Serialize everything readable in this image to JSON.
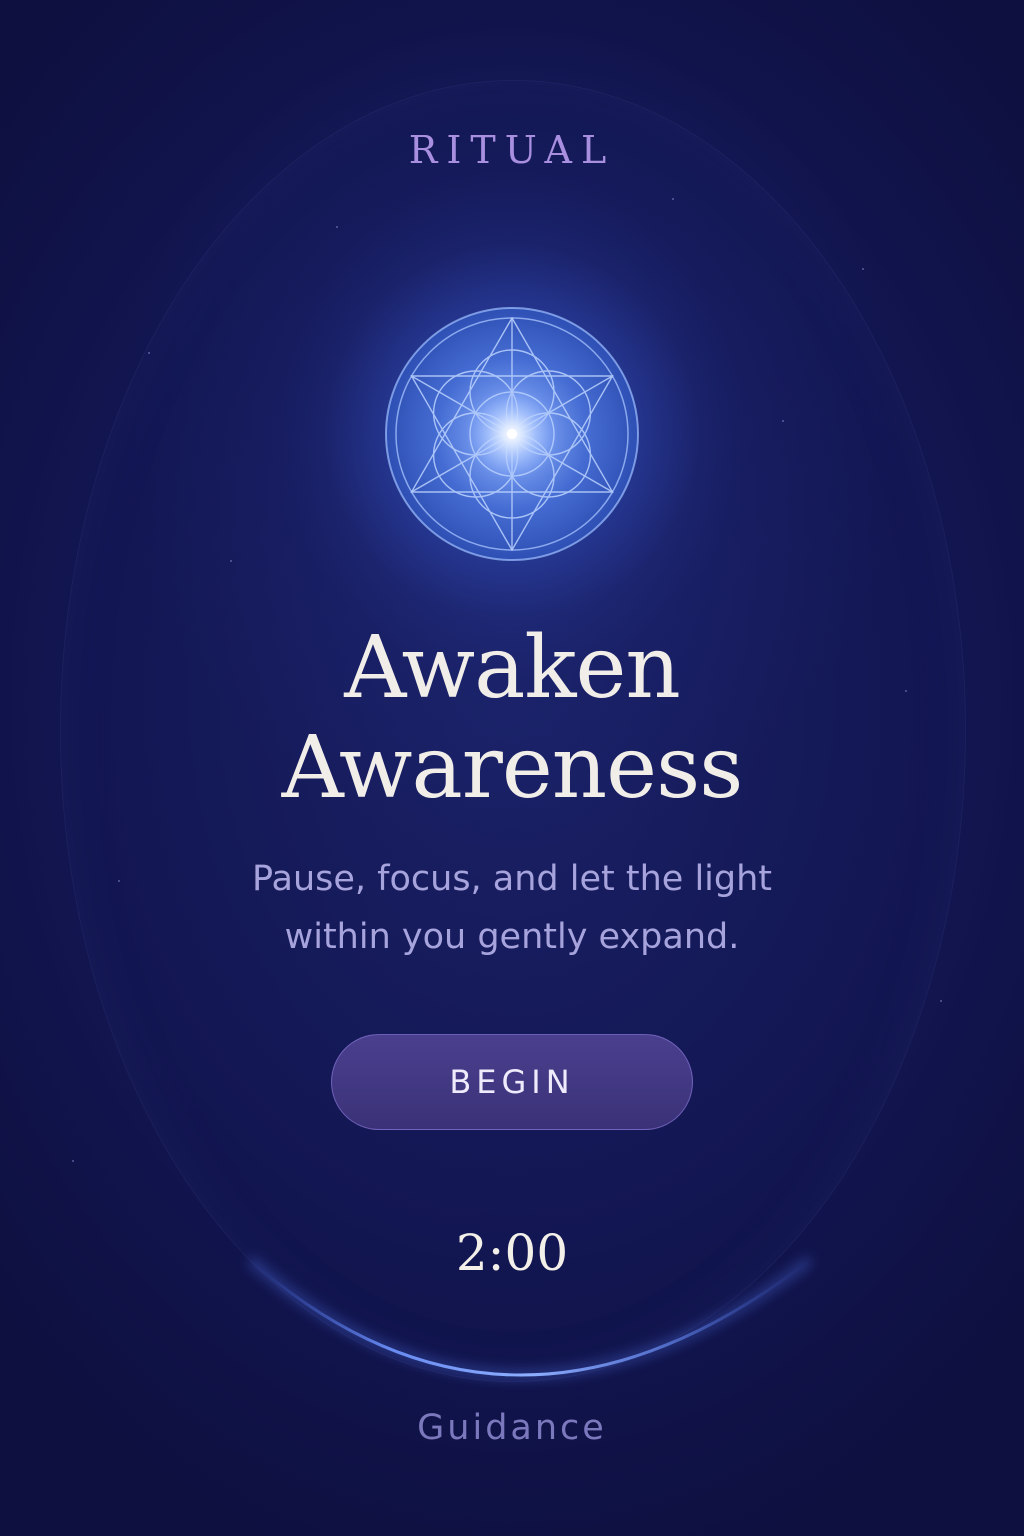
{
  "header": {
    "brand": "RITUAL"
  },
  "hero": {
    "icon": "flower-of-life-icon",
    "title_line1": "Awaken",
    "title_line2": "Awareness",
    "subtitle_line1": "Pause, focus, and let the light",
    "subtitle_line2": "within you gently expand."
  },
  "actions": {
    "begin_label": "BEGIN"
  },
  "timer": {
    "duration": "2:00"
  },
  "footer": {
    "guidance_label": "Guidance"
  },
  "colors": {
    "background": "#131754",
    "accent": "#a98fe0",
    "button": "#3a3278",
    "orb": "#5a8cff"
  }
}
